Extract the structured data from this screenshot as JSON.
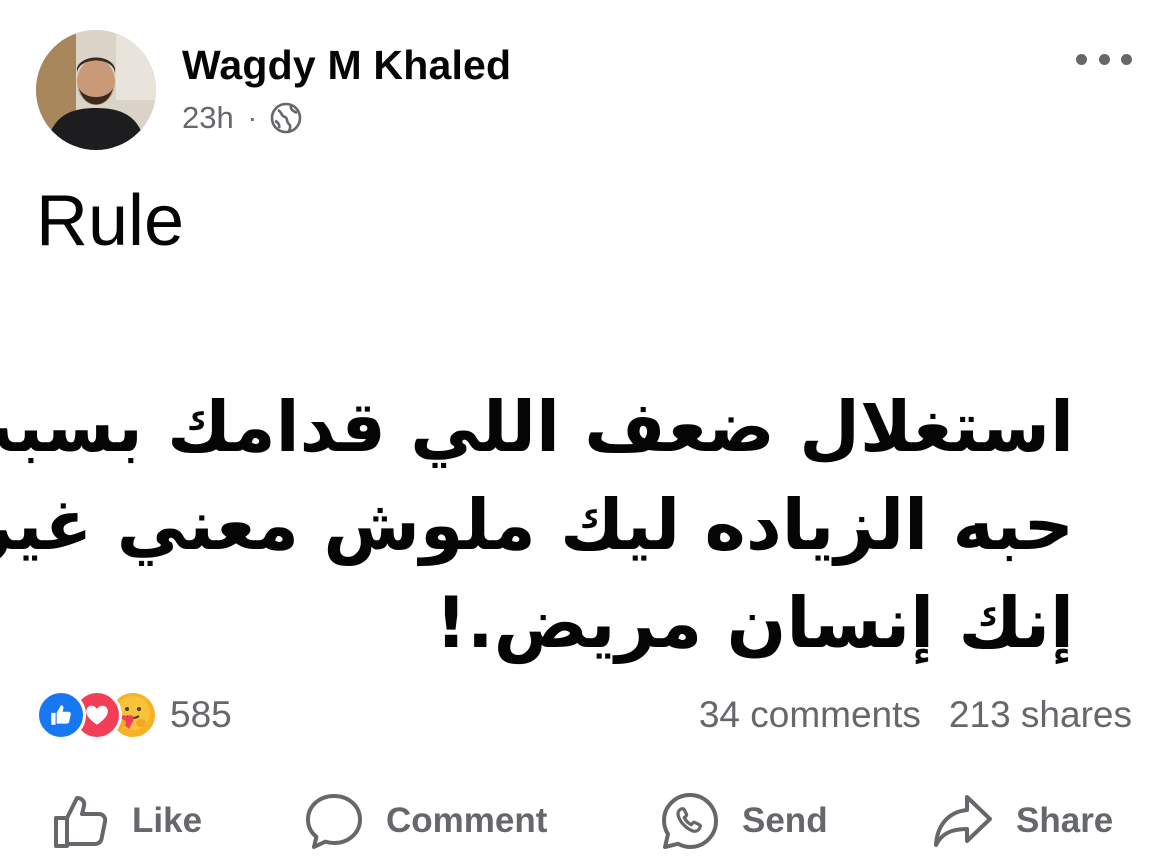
{
  "post": {
    "author": "Wagdy M Khaled",
    "time": "23h",
    "separator": "·",
    "privacy_icon": "globe-icon",
    "title": "Rule",
    "body_lines": [
      "استغلال ضعف اللي قدامك بسبب",
      "حبه الزياده ليك ملوش معني غير",
      "إنك إنسان مريض.!"
    ]
  },
  "reactions": {
    "icons": [
      "like-icon",
      "love-icon",
      "care-icon"
    ],
    "count": "585"
  },
  "stats": {
    "comments": "34 comments",
    "shares": "213 shares"
  },
  "actions": {
    "like": "Like",
    "comment": "Comment",
    "send": "Send",
    "share": "Share"
  },
  "colors": {
    "text_primary": "#050505",
    "text_secondary": "#65676b",
    "like_blue": "#1877f2",
    "love_red": "#f33e58",
    "care_yellow": "#f7b125"
  }
}
